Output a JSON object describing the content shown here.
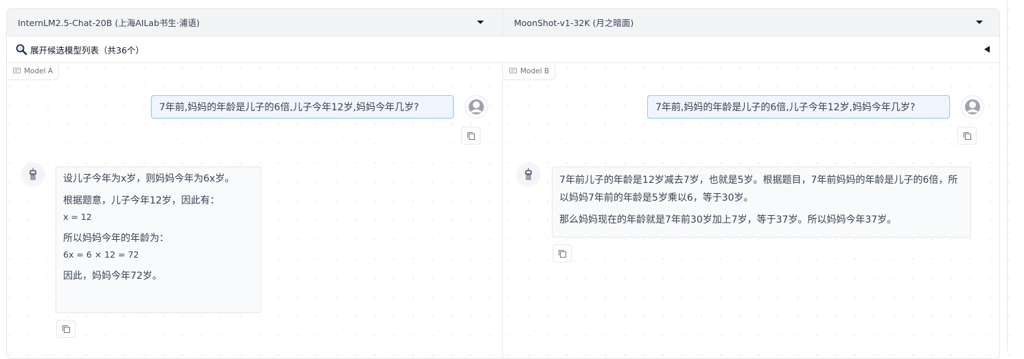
{
  "model_a": {
    "select_label": "InternLM2.5-Chat-20B (上海AILab书生·浦语)"
  },
  "model_b": {
    "select_label": "MoonShot-v1-32K (月之暗面)"
  },
  "expander": {
    "label": "展开候选模型列表（共36个）"
  },
  "pane_a": {
    "tag": "Model A",
    "user_message": "7年前,妈妈的年龄是儿子的6倍,儿子今年12岁,妈妈今年几岁?",
    "bot_lines": [
      "设儿子今年为x岁，则妈妈今年为6x岁。",
      "根据题意，儿子今年12岁，因此有：",
      "x = 12",
      "所以妈妈今年的年龄为：",
      "6x = 6 × 12 = 72",
      "因此，妈妈今年72岁。"
    ]
  },
  "pane_b": {
    "tag": "Model B",
    "user_message": "7年前,妈妈的年龄是儿子的6倍,儿子今年12岁,妈妈今年几岁?",
    "bot_paragraphs": [
      "7年前儿子的年龄是12岁减去7岁，也就是5岁。根据题目，7年前妈妈的年龄是儿子的6倍，所以妈妈7年前的年龄是5岁乘以6，等于30岁。",
      "那么妈妈现在的年龄就是7年前30岁加上7岁，等于37岁。所以妈妈今年37岁。"
    ]
  },
  "icons": {
    "dropdown": "chevron-down-icon",
    "search": "magnifier-icon",
    "collapse": "triangle-left-icon",
    "chat": "chat-icon",
    "copy": "copy-icon",
    "user": "user-avatar",
    "bot": "robot-avatar"
  },
  "colors": {
    "user_bubble_bg": "#eff6ff",
    "user_bubble_border": "#93c5fd",
    "bot_bubble_bg": "#f9fafb",
    "topbar_bg": "#f3f4f6"
  }
}
